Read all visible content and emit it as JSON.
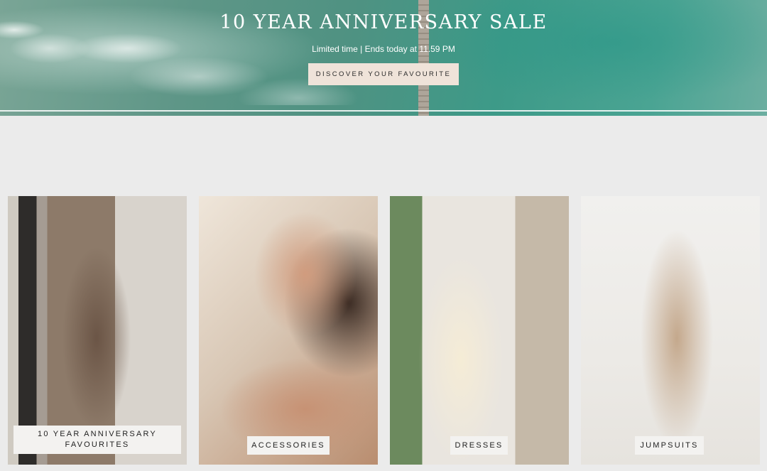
{
  "hero": {
    "title": "10 YEAR ANNIVERSARY SALE",
    "subtitle": "Limited time  |  Ends today at 11.59 PM",
    "cta_label": "DISCOVER YOUR FAVOURITE"
  },
  "categories": [
    {
      "label": "10 YEAR ANNIVERSARY\nFAVOURITES"
    },
    {
      "label": "ACCESSORIES"
    },
    {
      "label": "DRESSES"
    },
    {
      "label": "JUMPSUITS"
    }
  ],
  "colors": {
    "page_background": "#ebebeb",
    "cta_background": "#efe3d9",
    "label_background": "#f3f2f0"
  }
}
